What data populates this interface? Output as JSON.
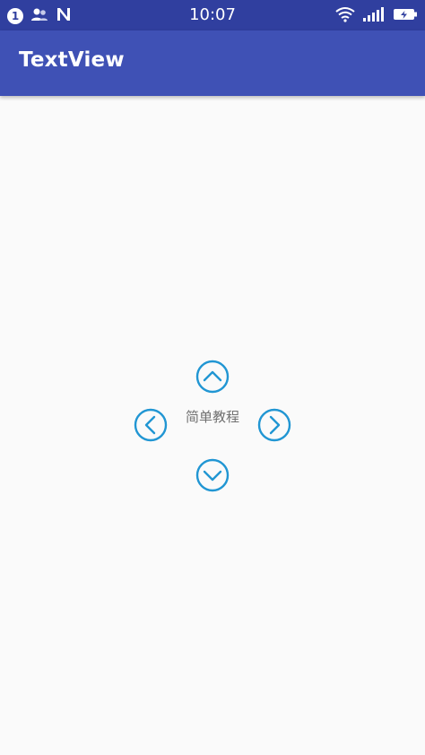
{
  "status_bar": {
    "notification_count": "1",
    "time": "10:07",
    "icons": [
      "notification-badge",
      "contacts-icon",
      "n-icon",
      "wifi-icon",
      "signal-icon",
      "battery-icon"
    ]
  },
  "app_bar": {
    "title": "TextView"
  },
  "content": {
    "center_text": "简单教程",
    "buttons": [
      "chevron-up-icon",
      "chevron-left-icon",
      "chevron-right-icon",
      "chevron-down-icon"
    ]
  },
  "colors": {
    "status_bar": "#303f9f",
    "app_bar": "#3f51b5",
    "accent": "#2196d3",
    "background": "#fafafa"
  }
}
